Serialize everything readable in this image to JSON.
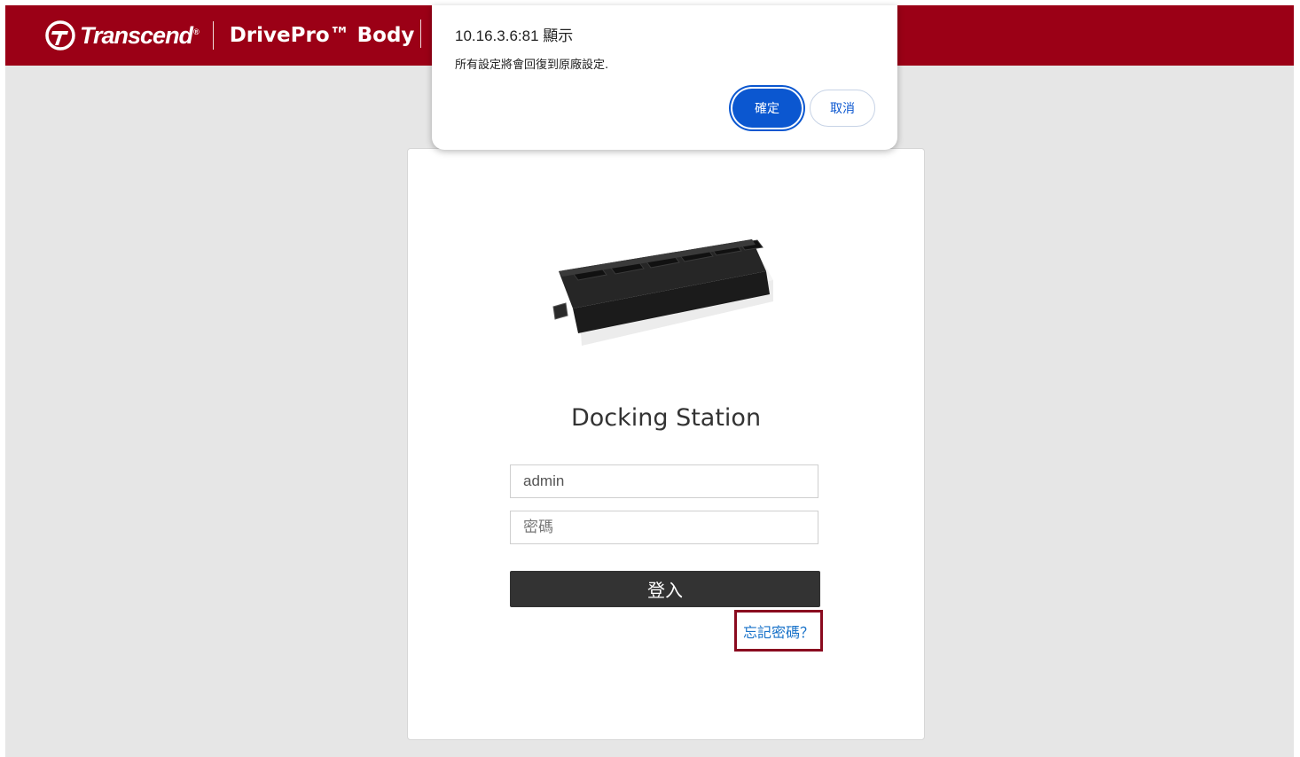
{
  "header": {
    "logo_text": "Transcend",
    "logo_mark": "®",
    "product_name": "DrivePro™ Body",
    "brand_color": "#9b0016"
  },
  "card": {
    "title": "Docking Station",
    "username_value": "admin",
    "password_placeholder": "密碼",
    "login_label": "登入",
    "forgot_password": "忘記密碼？",
    "device_image": "docking-station-image"
  },
  "dialog": {
    "origin": "10.16.3.6:81 顯示",
    "message": "所有設定將會回復到原廠設定.",
    "ok_label": "確定",
    "cancel_label": "取消",
    "accent_color": "#0b57d0"
  }
}
